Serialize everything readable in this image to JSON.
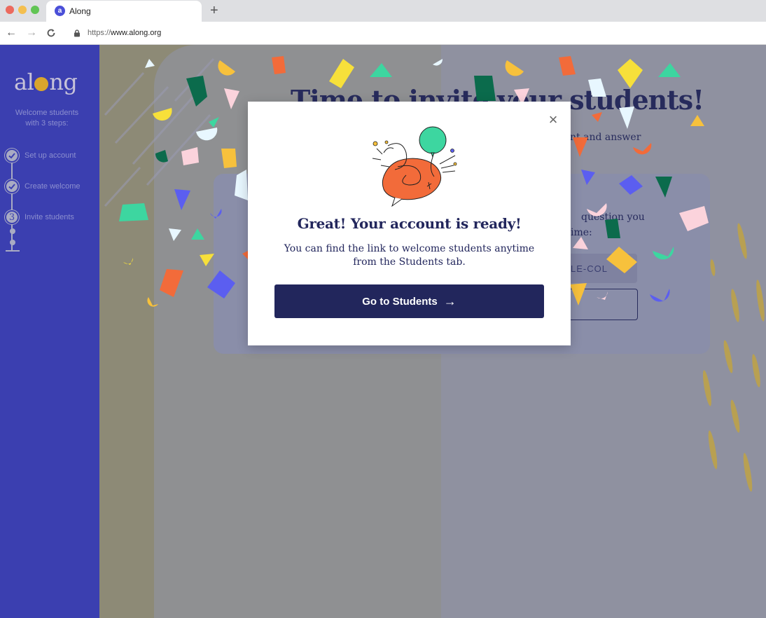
{
  "browser": {
    "tab_title": "Along",
    "favicon_letter": "a",
    "new_tab": "+",
    "url_prefix": "https://",
    "url_host": "www.along.org",
    "back": "←",
    "forward": "→",
    "reload": "C"
  },
  "sidebar": {
    "logo": {
      "left": "al",
      "right": "ng"
    },
    "subtitle_line1": "Welcome students",
    "subtitle_line2": "with 3 steps:",
    "steps": [
      {
        "label": "Set up account",
        "state": "done"
      },
      {
        "label": "Create welcome",
        "state": "done"
      },
      {
        "number": "3",
        "label": "Invite students",
        "state": "current"
      }
    ]
  },
  "page": {
    "heading_partial": "Time to invite your students!",
    "subtext_partial": "unt and answer",
    "card_line1": "question you",
    "card_line2": "ime:",
    "code_partial": "LE-COL"
  },
  "modal": {
    "close": "×",
    "title": "Great! Your account is ready!",
    "body": "You can find the link to welcome students anytime from the Students tab.",
    "cta_label": "Go to Students",
    "cta_arrow": "→"
  },
  "colors": {
    "sidebar": "#3b3fb0",
    "navy": "#22265c",
    "accent_orange": "#f26b3a",
    "balloon": "#3dd6a0"
  }
}
